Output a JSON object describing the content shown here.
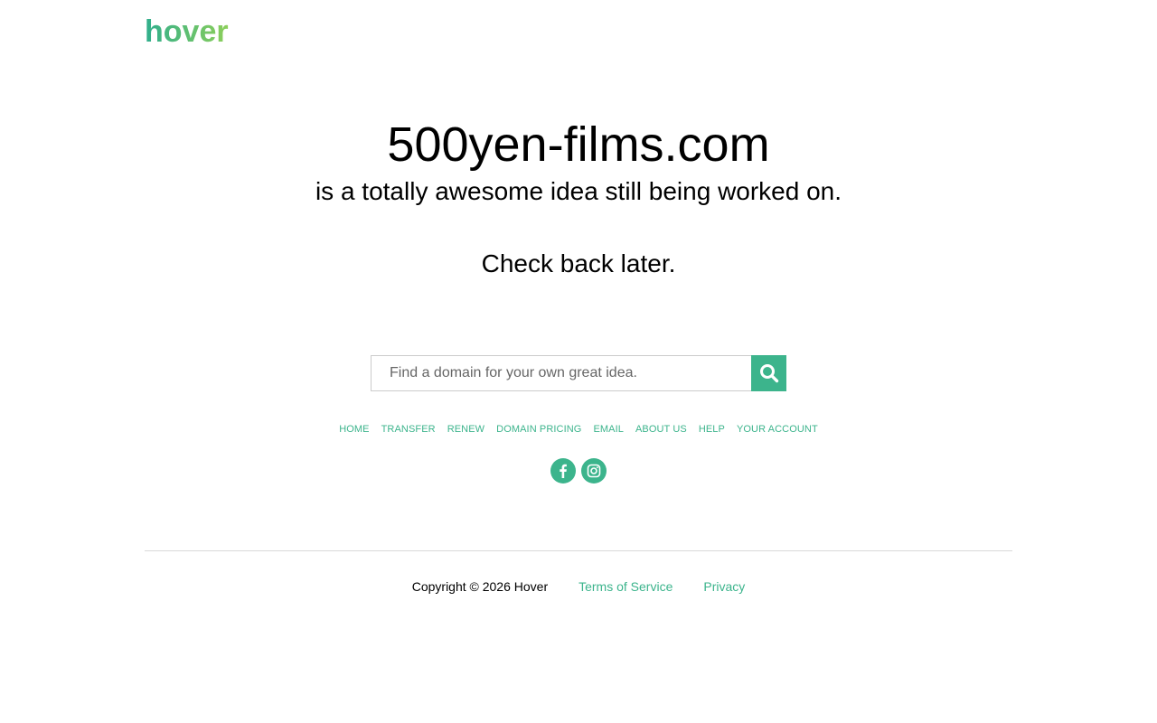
{
  "brand": {
    "logo_text": "hover",
    "accent_color": "#3cb48c",
    "logo_gradient": [
      "#2fae8c",
      "#8ccf5a"
    ]
  },
  "main": {
    "domain": "500yen-films.com",
    "tagline": "is a totally awesome idea still being worked on.",
    "check_back": "Check back later."
  },
  "search": {
    "placeholder": "Find a domain for your own great idea.",
    "value": "",
    "button_icon": "search-icon"
  },
  "nav": {
    "items": [
      {
        "label": "HOME"
      },
      {
        "label": "TRANSFER"
      },
      {
        "label": "RENEW"
      },
      {
        "label": "DOMAIN PRICING"
      },
      {
        "label": "EMAIL"
      },
      {
        "label": "ABOUT US"
      },
      {
        "label": "HELP"
      },
      {
        "label": "YOUR ACCOUNT"
      }
    ]
  },
  "social": {
    "icons": [
      "facebook-icon",
      "instagram-icon"
    ]
  },
  "footer": {
    "copyright": "Copyright © 2026 Hover",
    "terms_label": "Terms of Service",
    "privacy_label": "Privacy"
  }
}
